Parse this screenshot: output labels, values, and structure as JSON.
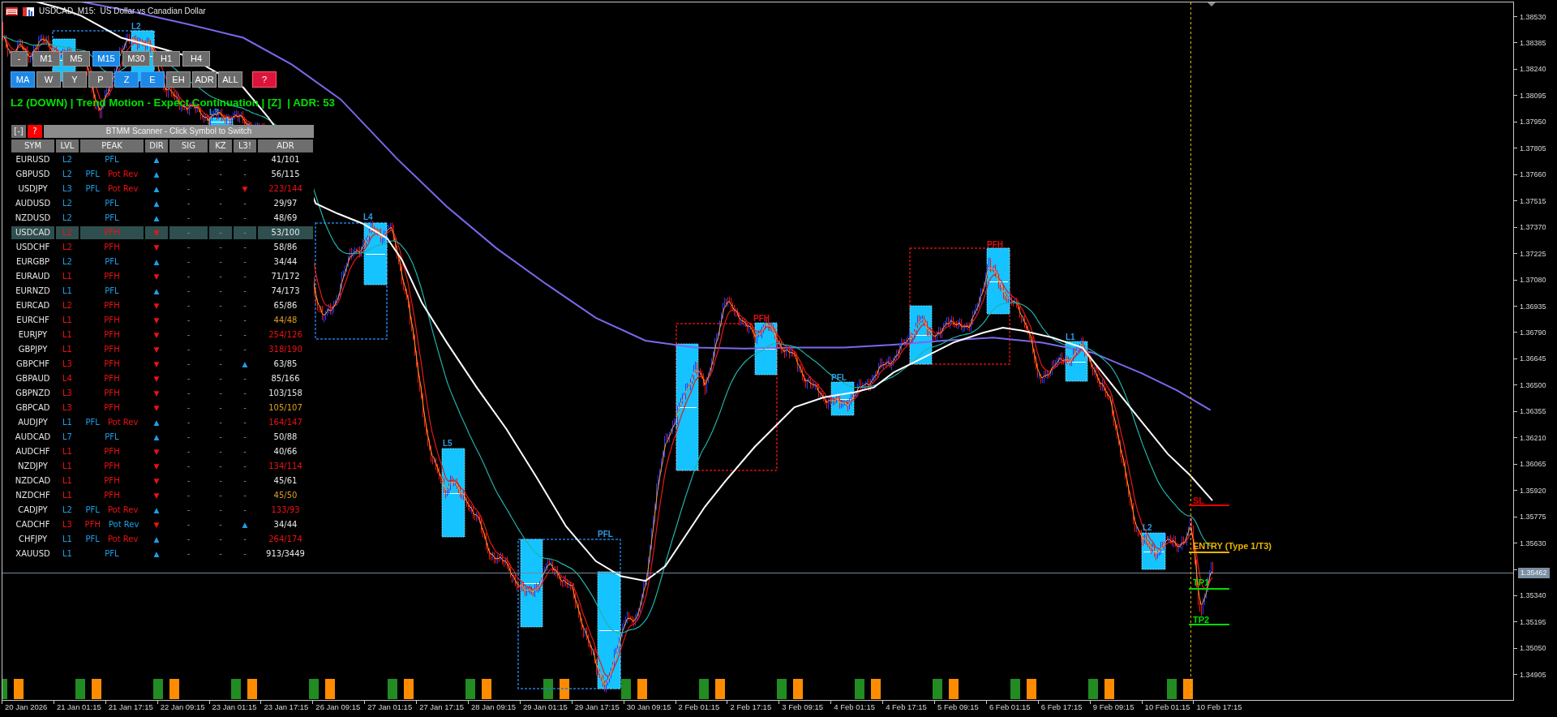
{
  "window": {
    "title": "USDCAD, M15:  US Dollar vs Canadian Dollar"
  },
  "toolbar": {
    "minimize_button": "-",
    "timeframes": [
      {
        "label": "M1",
        "selected": false
      },
      {
        "label": "M5",
        "selected": false
      },
      {
        "label": "M15",
        "selected": true
      },
      {
        "label": "M30",
        "selected": false
      },
      {
        "label": "H1",
        "selected": false
      },
      {
        "label": "H4",
        "selected": false
      }
    ],
    "toggles": [
      {
        "label": "MA",
        "on": true
      },
      {
        "label": "W",
        "on": false
      },
      {
        "label": "Y",
        "on": false
      },
      {
        "label": "P",
        "on": false
      },
      {
        "label": "Z",
        "on": true
      },
      {
        "label": "E",
        "on": true
      },
      {
        "label": "EH",
        "on": false
      },
      {
        "label": "ADR",
        "on": false
      },
      {
        "label": "ALL",
        "on": false
      }
    ],
    "help_button": "?"
  },
  "status_line": "L2 (DOWN) | Trend Motion - Expect Continuation | [Z]  | ADR: 53",
  "scanner": {
    "collapse_button": "[-]",
    "help_button": "?",
    "title": "BTMM Scanner - Click Symbol to Switch",
    "columns": [
      "SYM",
      "LVL",
      "PEAK",
      "DIR",
      "SIG",
      "KZ",
      "L3!",
      "ADR"
    ],
    "rows": [
      {
        "sym": "EURUSD",
        "lvl": {
          "text": "L2",
          "color": "#1e9fe8"
        },
        "peak": [
          {
            "text": "PFL",
            "color": "#1e9fe8"
          }
        ],
        "dir": {
          "text": "▲",
          "color": "#1e9fe8"
        },
        "sig": "-",
        "kz": "-",
        "l3": {
          "text": "-"
        },
        "adr": {
          "text": "41/101",
          "color": "#e6e6e6"
        },
        "selected": false
      },
      {
        "sym": "GBPUSD",
        "lvl": {
          "text": "L2",
          "color": "#1e9fe8"
        },
        "peak": [
          {
            "text": "PFL",
            "color": "#1e9fe8"
          },
          {
            "text": "Pot Rev",
            "color": "#ee1111"
          }
        ],
        "dir": {
          "text": "▲",
          "color": "#1e9fe8"
        },
        "sig": "-",
        "kz": "-",
        "l3": {
          "text": "-"
        },
        "adr": {
          "text": "56/115",
          "color": "#e6e6e6"
        },
        "selected": false
      },
      {
        "sym": "USDJPY",
        "lvl": {
          "text": "L3",
          "color": "#1e9fe8"
        },
        "peak": [
          {
            "text": "PFL",
            "color": "#1e9fe8"
          },
          {
            "text": "Pot Rev",
            "color": "#ee1111"
          }
        ],
        "dir": {
          "text": "▲",
          "color": "#1e9fe8"
        },
        "sig": "-",
        "kz": "-",
        "l3": {
          "text": "▼",
          "color": "#ee1111"
        },
        "adr": {
          "text": "223/144",
          "color": "#ee1111"
        },
        "selected": false
      },
      {
        "sym": "AUDUSD",
        "lvl": {
          "text": "L2",
          "color": "#1e9fe8"
        },
        "peak": [
          {
            "text": "PFL",
            "color": "#1e9fe8"
          }
        ],
        "dir": {
          "text": "▲",
          "color": "#1e9fe8"
        },
        "sig": "-",
        "kz": "-",
        "l3": {
          "text": "-"
        },
        "adr": {
          "text": "29/97",
          "color": "#e6e6e6"
        },
        "selected": false
      },
      {
        "sym": "NZDUSD",
        "lvl": {
          "text": "L2",
          "color": "#1e9fe8"
        },
        "peak": [
          {
            "text": "PFL",
            "color": "#1e9fe8"
          }
        ],
        "dir": {
          "text": "▲",
          "color": "#1e9fe8"
        },
        "sig": "-",
        "kz": "-",
        "l3": {
          "text": "-"
        },
        "adr": {
          "text": "48/69",
          "color": "#e6e6e6"
        },
        "selected": false
      },
      {
        "sym": "USDCAD",
        "lvl": {
          "text": "L2",
          "color": "#ee1111"
        },
        "peak": [
          {
            "text": "PFH",
            "color": "#ee1111"
          }
        ],
        "dir": {
          "text": "▼",
          "color": "#ee1111"
        },
        "sig": "-",
        "kz": "-",
        "l3": {
          "text": "-"
        },
        "adr": {
          "text": "53/100",
          "color": "#e6e6e6"
        },
        "selected": true
      },
      {
        "sym": "USDCHF",
        "lvl": {
          "text": "L2",
          "color": "#ee1111"
        },
        "peak": [
          {
            "text": "PFH",
            "color": "#ee1111"
          }
        ],
        "dir": {
          "text": "▼",
          "color": "#ee1111"
        },
        "sig": "-",
        "kz": "-",
        "l3": {
          "text": "-"
        },
        "adr": {
          "text": "58/86",
          "color": "#e6e6e6"
        },
        "selected": false
      },
      {
        "sym": "EURGBP",
        "lvl": {
          "text": "L2",
          "color": "#1e9fe8"
        },
        "peak": [
          {
            "text": "PFL",
            "color": "#1e9fe8"
          }
        ],
        "dir": {
          "text": "▲",
          "color": "#1e9fe8"
        },
        "sig": "-",
        "kz": "-",
        "l3": {
          "text": "-"
        },
        "adr": {
          "text": "34/44",
          "color": "#e6e6e6"
        },
        "selected": false
      },
      {
        "sym": "EURAUD",
        "lvl": {
          "text": "L1",
          "color": "#ee1111"
        },
        "peak": [
          {
            "text": "PFH",
            "color": "#ee1111"
          }
        ],
        "dir": {
          "text": "▼",
          "color": "#ee1111"
        },
        "sig": "-",
        "kz": "-",
        "l3": {
          "text": "-"
        },
        "adr": {
          "text": "71/172",
          "color": "#e6e6e6"
        },
        "selected": false
      },
      {
        "sym": "EURNZD",
        "lvl": {
          "text": "L1",
          "color": "#1e9fe8"
        },
        "peak": [
          {
            "text": "PFL",
            "color": "#1e9fe8"
          }
        ],
        "dir": {
          "text": "▲",
          "color": "#1e9fe8"
        },
        "sig": "-",
        "kz": "-",
        "l3": {
          "text": "-"
        },
        "adr": {
          "text": "74/173",
          "color": "#e6e6e6"
        },
        "selected": false
      },
      {
        "sym": "EURCAD",
        "lvl": {
          "text": "L2",
          "color": "#ee1111"
        },
        "peak": [
          {
            "text": "PFH",
            "color": "#ee1111"
          }
        ],
        "dir": {
          "text": "▼",
          "color": "#ee1111"
        },
        "sig": "-",
        "kz": "-",
        "l3": {
          "text": "-"
        },
        "adr": {
          "text": "65/86",
          "color": "#e6e6e6"
        },
        "selected": false
      },
      {
        "sym": "EURCHF",
        "lvl": {
          "text": "L1",
          "color": "#ee1111"
        },
        "peak": [
          {
            "text": "PFH",
            "color": "#ee1111"
          }
        ],
        "dir": {
          "text": "▼",
          "color": "#ee1111"
        },
        "sig": "-",
        "kz": "-",
        "l3": {
          "text": "-"
        },
        "adr": {
          "text": "44/48",
          "color": "#dba01e"
        },
        "selected": false
      },
      {
        "sym": "EURJPY",
        "lvl": {
          "text": "L1",
          "color": "#ee1111"
        },
        "peak": [
          {
            "text": "PFH",
            "color": "#ee1111"
          }
        ],
        "dir": {
          "text": "▼",
          "color": "#ee1111"
        },
        "sig": "-",
        "kz": "-",
        "l3": {
          "text": "-"
        },
        "adr": {
          "text": "254/126",
          "color": "#ee1111"
        },
        "selected": false
      },
      {
        "sym": "GBPJPY",
        "lvl": {
          "text": "L1",
          "color": "#ee1111"
        },
        "peak": [
          {
            "text": "PFH",
            "color": "#ee1111"
          }
        ],
        "dir": {
          "text": "▼",
          "color": "#ee1111"
        },
        "sig": "-",
        "kz": "-",
        "l3": {
          "text": "-"
        },
        "adr": {
          "text": "318/190",
          "color": "#ee1111"
        },
        "selected": false
      },
      {
        "sym": "GBPCHF",
        "lvl": {
          "text": "L3",
          "color": "#ee1111"
        },
        "peak": [
          {
            "text": "PFH",
            "color": "#ee1111"
          }
        ],
        "dir": {
          "text": "▼",
          "color": "#ee1111"
        },
        "sig": "-",
        "kz": "-",
        "l3": {
          "text": "▲",
          "color": "#1e9fe8"
        },
        "adr": {
          "text": "63/85",
          "color": "#e6e6e6"
        },
        "selected": false
      },
      {
        "sym": "GBPAUD",
        "lvl": {
          "text": "L4",
          "color": "#ee1111"
        },
        "peak": [
          {
            "text": "PFH",
            "color": "#ee1111"
          }
        ],
        "dir": {
          "text": "▼",
          "color": "#ee1111"
        },
        "sig": "-",
        "kz": "-",
        "l3": {
          "text": "-"
        },
        "adr": {
          "text": "85/166",
          "color": "#e6e6e6"
        },
        "selected": false
      },
      {
        "sym": "GBPNZD",
        "lvl": {
          "text": "L3",
          "color": "#ee1111"
        },
        "peak": [
          {
            "text": "PFH",
            "color": "#ee1111"
          }
        ],
        "dir": {
          "text": "▼",
          "color": "#ee1111"
        },
        "sig": "-",
        "kz": "-",
        "l3": {
          "text": "-"
        },
        "adr": {
          "text": "103/158",
          "color": "#e6e6e6"
        },
        "selected": false
      },
      {
        "sym": "GBPCAD",
        "lvl": {
          "text": "L3",
          "color": "#ee1111"
        },
        "peak": [
          {
            "text": "PFH",
            "color": "#ee1111"
          }
        ],
        "dir": {
          "text": "▼",
          "color": "#ee1111"
        },
        "sig": "-",
        "kz": "-",
        "l3": {
          "text": "-"
        },
        "adr": {
          "text": "105/107",
          "color": "#dba01e"
        },
        "selected": false
      },
      {
        "sym": "AUDJPY",
        "lvl": {
          "text": "L1",
          "color": "#1e9fe8"
        },
        "peak": [
          {
            "text": "PFL",
            "color": "#1e9fe8"
          },
          {
            "text": "Pot Rev",
            "color": "#ee1111"
          }
        ],
        "dir": {
          "text": "▲",
          "color": "#1e9fe8"
        },
        "sig": "-",
        "kz": "-",
        "l3": {
          "text": "-"
        },
        "adr": {
          "text": "164/147",
          "color": "#ee1111"
        },
        "selected": false
      },
      {
        "sym": "AUDCAD",
        "lvl": {
          "text": "L7",
          "color": "#1e9fe8"
        },
        "peak": [
          {
            "text": "PFL",
            "color": "#1e9fe8"
          }
        ],
        "dir": {
          "text": "▲",
          "color": "#1e9fe8"
        },
        "sig": "-",
        "kz": "-",
        "l3": {
          "text": "-"
        },
        "adr": {
          "text": "50/88",
          "color": "#e6e6e6"
        },
        "selected": false
      },
      {
        "sym": "AUDCHF",
        "lvl": {
          "text": "L1",
          "color": "#ee1111"
        },
        "peak": [
          {
            "text": "PFH",
            "color": "#ee1111"
          }
        ],
        "dir": {
          "text": "▼",
          "color": "#ee1111"
        },
        "sig": "-",
        "kz": "-",
        "l3": {
          "text": "-"
        },
        "adr": {
          "text": "40/66",
          "color": "#e6e6e6"
        },
        "selected": false
      },
      {
        "sym": "NZDJPY",
        "lvl": {
          "text": "L1",
          "color": "#ee1111"
        },
        "peak": [
          {
            "text": "PFH",
            "color": "#ee1111"
          }
        ],
        "dir": {
          "text": "▼",
          "color": "#ee1111"
        },
        "sig": "-",
        "kz": "-",
        "l3": {
          "text": "-"
        },
        "adr": {
          "text": "134/114",
          "color": "#ee1111"
        },
        "selected": false
      },
      {
        "sym": "NZDCAD",
        "lvl": {
          "text": "L1",
          "color": "#ee1111"
        },
        "peak": [
          {
            "text": "PFH",
            "color": "#ee1111"
          }
        ],
        "dir": {
          "text": "▼",
          "color": "#ee1111"
        },
        "sig": "-",
        "kz": "-",
        "l3": {
          "text": "-"
        },
        "adr": {
          "text": "45/61",
          "color": "#e6e6e6"
        },
        "selected": false
      },
      {
        "sym": "NZDCHF",
        "lvl": {
          "text": "L1",
          "color": "#ee1111"
        },
        "peak": [
          {
            "text": "PFH",
            "color": "#ee1111"
          }
        ],
        "dir": {
          "text": "▼",
          "color": "#ee1111"
        },
        "sig": "-",
        "kz": "-",
        "l3": {
          "text": "-"
        },
        "adr": {
          "text": "45/50",
          "color": "#dba01e"
        },
        "selected": false
      },
      {
        "sym": "CADJPY",
        "lvl": {
          "text": "L2",
          "color": "#1e9fe8"
        },
        "peak": [
          {
            "text": "PFL",
            "color": "#1e9fe8"
          },
          {
            "text": "Pot Rev",
            "color": "#ee1111"
          }
        ],
        "dir": {
          "text": "▲",
          "color": "#1e9fe8"
        },
        "sig": "-",
        "kz": "-",
        "l3": {
          "text": "-"
        },
        "adr": {
          "text": "133/93",
          "color": "#ee1111"
        },
        "selected": false
      },
      {
        "sym": "CADCHF",
        "lvl": {
          "text": "L3",
          "color": "#ee1111"
        },
        "peak": [
          {
            "text": "PFH",
            "color": "#ee1111"
          },
          {
            "text": "Pot Rev",
            "color": "#1e9fe8"
          }
        ],
        "dir": {
          "text": "▼",
          "color": "#ee1111"
        },
        "sig": "-",
        "kz": "-",
        "l3": {
          "text": "▲",
          "color": "#1e9fe8"
        },
        "adr": {
          "text": "34/44",
          "color": "#e6e6e6"
        },
        "selected": false
      },
      {
        "sym": "CHFJPY",
        "lvl": {
          "text": "L1",
          "color": "#1e9fe8"
        },
        "peak": [
          {
            "text": "PFL",
            "color": "#1e9fe8"
          },
          {
            "text": "Pot Rev",
            "color": "#ee1111"
          }
        ],
        "dir": {
          "text": "▲",
          "color": "#1e9fe8"
        },
        "sig": "-",
        "kz": "-",
        "l3": {
          "text": "-"
        },
        "adr": {
          "text": "264/174",
          "color": "#ee1111"
        },
        "selected": false
      },
      {
        "sym": "XAUUSD",
        "lvl": {
          "text": "L1",
          "color": "#1e9fe8"
        },
        "peak": [
          {
            "text": "PFL",
            "color": "#1e9fe8"
          }
        ],
        "dir": {
          "text": "▲",
          "color": "#1e9fe8"
        },
        "sig": "-",
        "kz": "-",
        "l3": {
          "text": "-"
        },
        "adr": {
          "text": "913/3449",
          "color": "#e6e6e6"
        },
        "selected": false
      }
    ]
  },
  "chart": {
    "zone_labels": [
      {
        "text": "L2",
        "color": "#2f9be6"
      },
      {
        "text": "L3",
        "color": "#2f9be6"
      },
      {
        "text": "L4",
        "color": "#2f9be6"
      },
      {
        "text": "L5",
        "color": "#2f9be6"
      },
      {
        "text": "PFL",
        "color": "#2f9be6"
      },
      {
        "text": "PFH",
        "color": "#e01010"
      },
      {
        "text": "PFL",
        "color": "#2f9be6"
      },
      {
        "text": "PFH",
        "color": "#e01010"
      },
      {
        "text": "L1",
        "color": "#2f9be6"
      },
      {
        "text": "L2",
        "color": "#2f9be6"
      }
    ],
    "trade_levels": [
      {
        "label": "SL",
        "kind": "stop"
      },
      {
        "label": "ENTRY (Type 1/T3)",
        "kind": "entry"
      },
      {
        "label": "TP1",
        "kind": "target"
      },
      {
        "label": "TP2",
        "kind": "target"
      }
    ]
  },
  "price_axis": {
    "ticks": [
      {
        "kind": "tick",
        "label": "1.38530"
      },
      {
        "kind": "tick",
        "label": "1.38385"
      },
      {
        "kind": "tick",
        "label": "1.38240"
      },
      {
        "kind": "tick",
        "label": "1.38095"
      },
      {
        "kind": "tick",
        "label": "1.37950"
      },
      {
        "kind": "tick",
        "label": "1.37805"
      },
      {
        "kind": "tick",
        "label": "1.37660"
      },
      {
        "kind": "tick",
        "label": "1.37515"
      },
      {
        "kind": "tick",
        "label": "1.37370"
      },
      {
        "kind": "tick",
        "label": "1.37225"
      },
      {
        "kind": "tick",
        "label": "1.37080"
      },
      {
        "kind": "tick",
        "label": "1.36935"
      },
      {
        "kind": "tick",
        "label": "1.36790"
      },
      {
        "kind": "tick",
        "label": "1.36645"
      },
      {
        "kind": "tick",
        "label": "1.36500"
      },
      {
        "kind": "tick",
        "label": "1.36355"
      },
      {
        "kind": "tick",
        "label": "1.36210"
      },
      {
        "kind": "tick",
        "label": "1.36065"
      },
      {
        "kind": "tick",
        "label": "1.35920"
      },
      {
        "kind": "tick",
        "label": "1.35775"
      },
      {
        "kind": "tick",
        "label": "1.35630"
      },
      {
        "kind": "current",
        "label": "1.35462"
      },
      {
        "kind": "tick",
        "label": "1.35340"
      },
      {
        "kind": "tick",
        "label": "1.35195"
      },
      {
        "kind": "tick",
        "label": "1.35050"
      },
      {
        "kind": "tick",
        "label": "1.34905"
      }
    ]
  },
  "time_axis": {
    "labels": [
      "20 Jan 2026",
      "21 Jan 01:15",
      "21 Jan 17:15",
      "22 Jan 09:15",
      "23 Jan 01:15",
      "23 Jan 17:15",
      "26 Jan 09:15",
      "27 Jan 01:15",
      "27 Jan 17:15",
      "28 Jan 09:15",
      "29 Jan 01:15",
      "29 Jan 17:15",
      "30 Jan 09:15",
      "2 Feb 01:15",
      "2 Feb 17:15",
      "3 Feb 09:15",
      "4 Feb 01:15",
      "4 Feb 17:15",
      "5 Feb 09:15",
      "6 Feb 01:15",
      "6 Feb 17:15",
      "9 Feb 09:15",
      "10 Feb 01:15",
      "10 Feb 17:15"
    ]
  }
}
